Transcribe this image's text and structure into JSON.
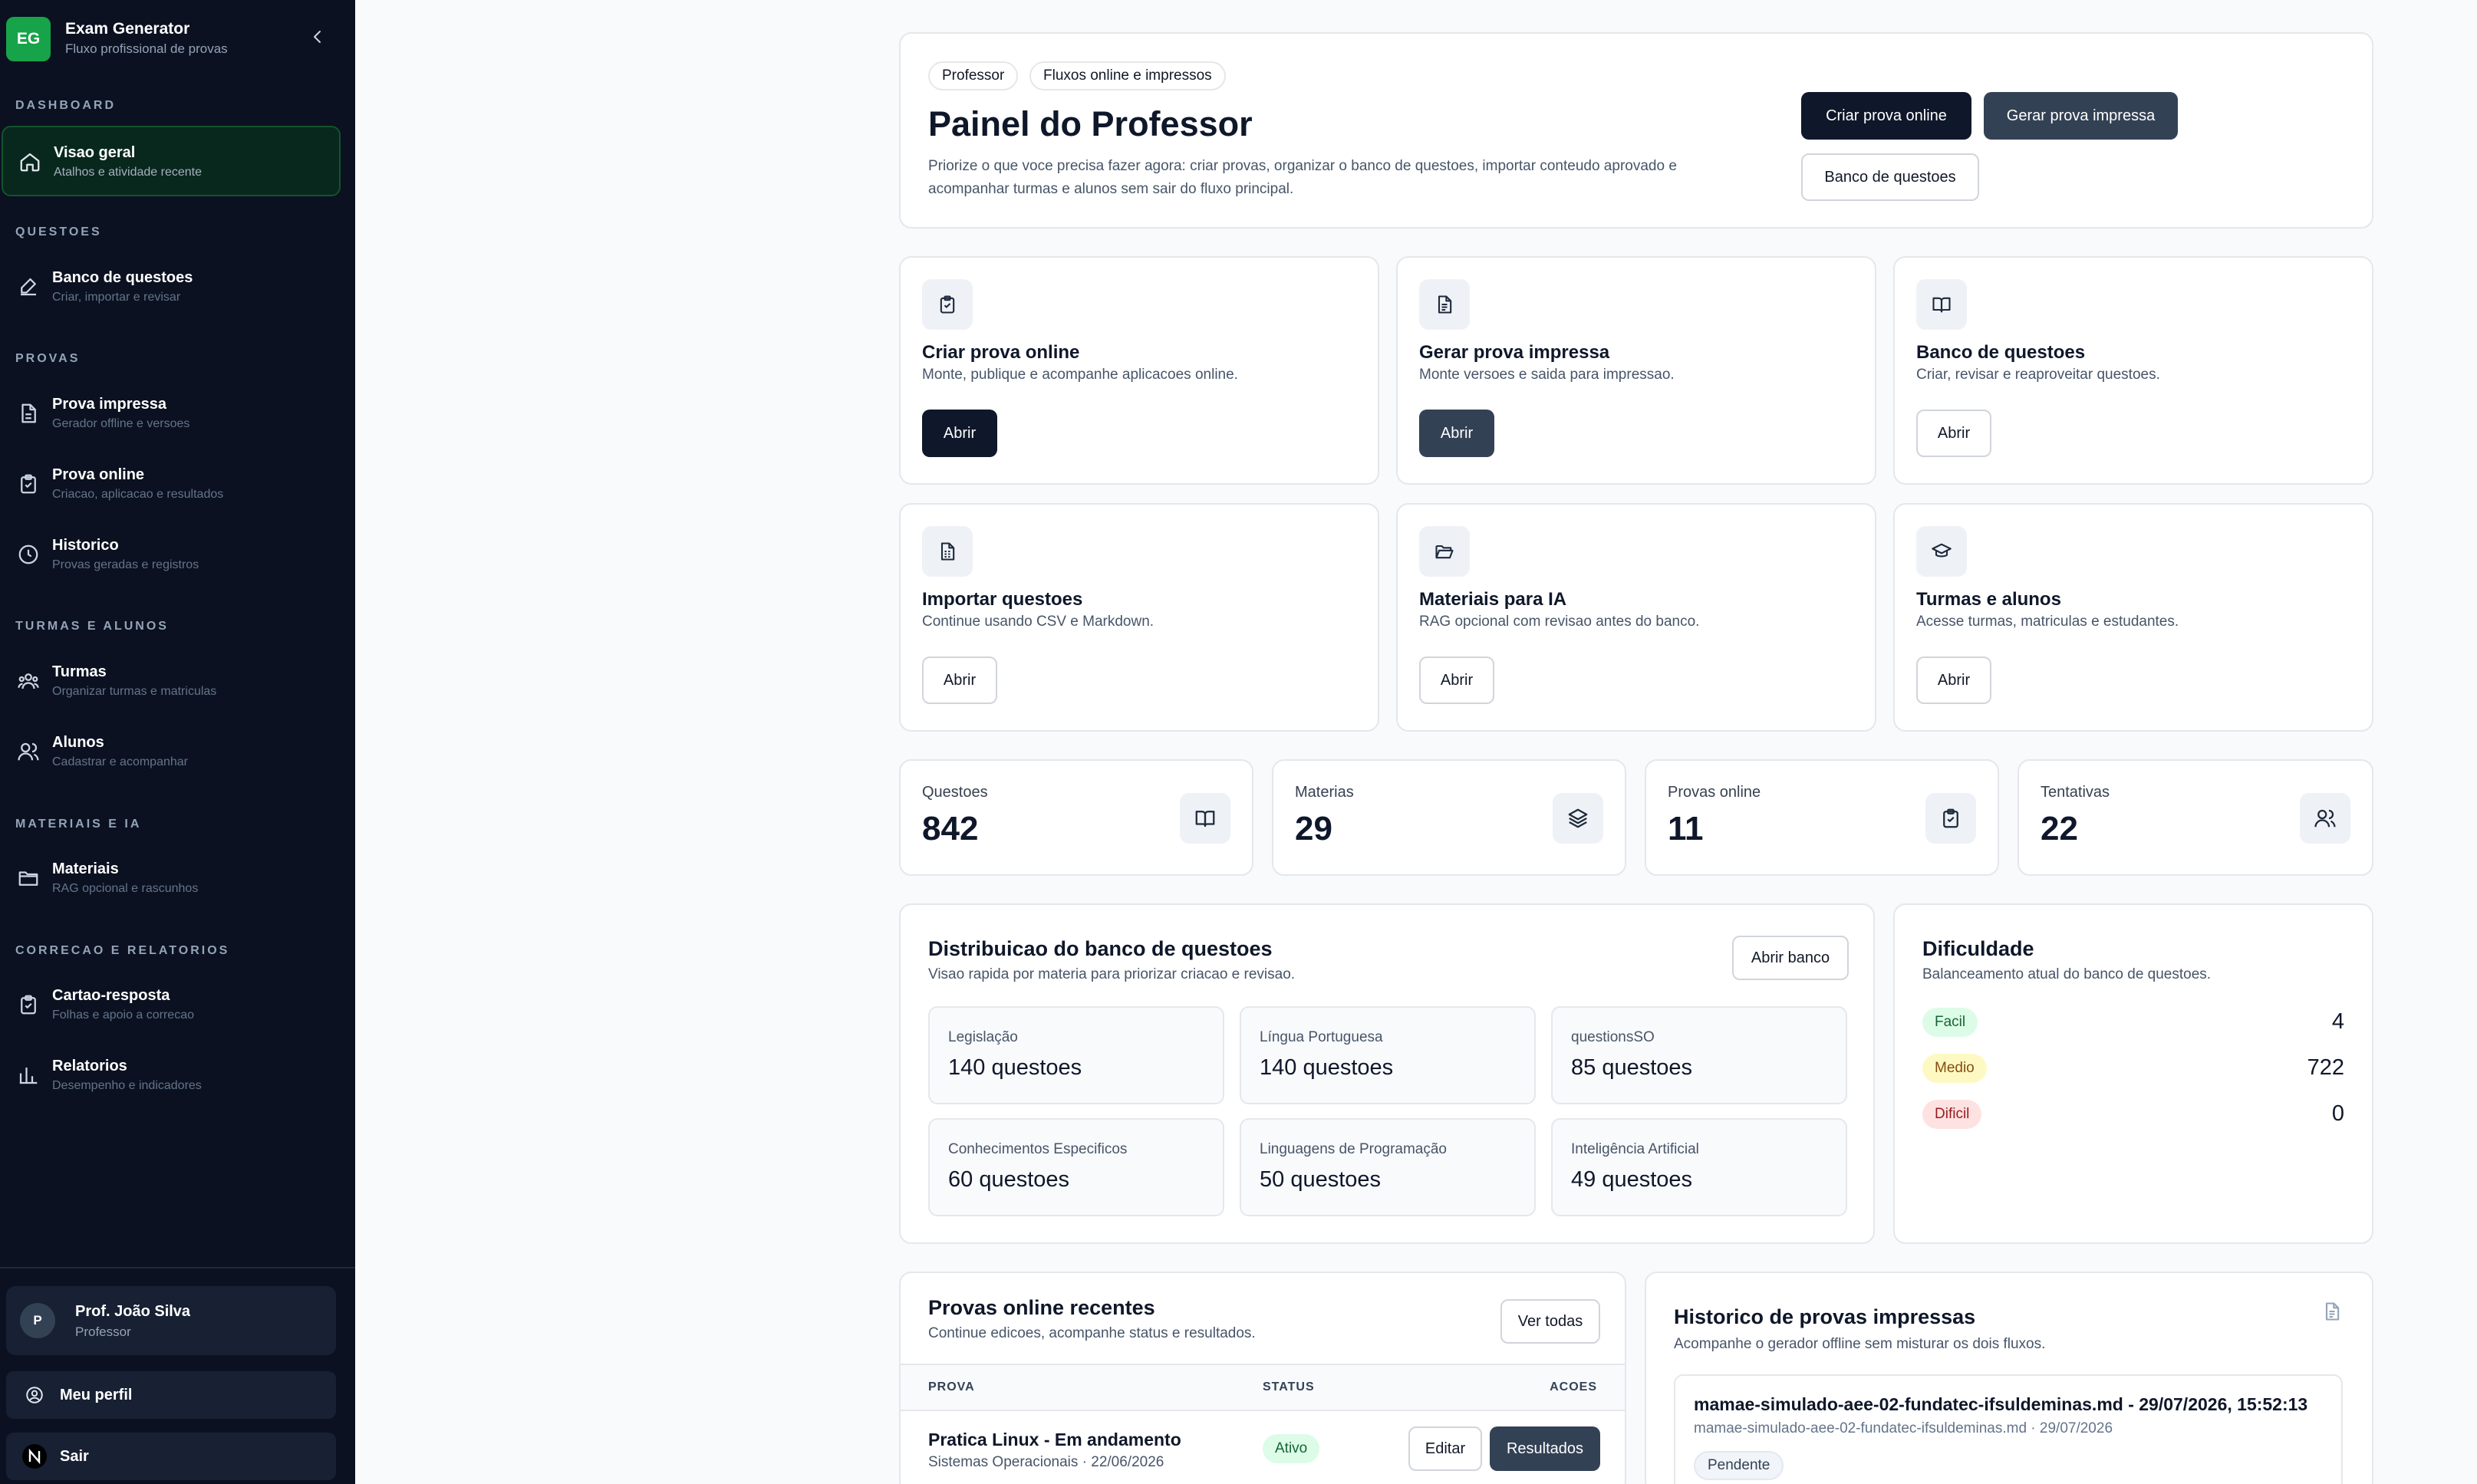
{
  "brand": {
    "logo": "EG",
    "title": "Exam Generator",
    "subtitle": "Fluxo profissional de provas"
  },
  "sidebar": {
    "sections": [
      "DASHBOARD",
      "QUESTOES",
      "PROVAS",
      "TURMAS E ALUNOS",
      "MATERIAIS E IA",
      "CORRECAO E RELATORIOS"
    ],
    "items": [
      {
        "title": "Visao geral",
        "sub": "Atalhos e atividade recente",
        "icon": "home-icon"
      },
      {
        "title": "Banco de questoes",
        "sub": "Criar, importar e revisar",
        "icon": "edit-icon"
      },
      {
        "title": "Prova impressa",
        "sub": "Gerador offline e versoes",
        "icon": "file-icon"
      },
      {
        "title": "Prova online",
        "sub": "Criacao, aplicacao e resultados",
        "icon": "clipboard-icon"
      },
      {
        "title": "Historico",
        "sub": "Provas geradas e registros",
        "icon": "clock-icon"
      },
      {
        "title": "Turmas",
        "sub": "Organizar turmas e matriculas",
        "icon": "group-icon"
      },
      {
        "title": "Alunos",
        "sub": "Cadastrar e acompanhar",
        "icon": "users-icon"
      },
      {
        "title": "Materiais",
        "sub": "RAG opcional e rascunhos",
        "icon": "folder-icon"
      },
      {
        "title": "Cartao-resposta",
        "sub": "Folhas e apoio a correcao",
        "icon": "clipboard-icon"
      },
      {
        "title": "Relatorios",
        "sub": "Desempenho e indicadores",
        "icon": "bar-chart-icon"
      }
    ],
    "user": {
      "initial": "P",
      "name": "Prof. João Silva",
      "role": "Professor"
    },
    "profile_label": "Meu perfil",
    "logout_label": "Sair"
  },
  "header": {
    "chips": [
      "Professor",
      "Fluxos online e impressos"
    ],
    "title": "Painel do Professor",
    "description": "Priorize o que voce precisa fazer agora: criar provas, organizar o banco de questoes, importar conteudo aprovado e acompanhar turmas e alunos sem sair do fluxo principal.",
    "btn_online": "Criar prova online",
    "btn_print": "Gerar prova impressa",
    "btn_bank": "Banco de questoes"
  },
  "actions": [
    {
      "title": "Criar prova online",
      "desc": "Monte, publique e acompanhe aplicacoes online.",
      "button": "Abrir",
      "icon": "clipboard-check-icon"
    },
    {
      "title": "Gerar prova impressa",
      "desc": "Monte versoes e saida para impressao.",
      "button": "Abrir",
      "icon": "file-text-icon"
    },
    {
      "title": "Banco de questoes",
      "desc": "Criar, revisar e reaproveitar questoes.",
      "button": "Abrir",
      "icon": "book-open-icon"
    },
    {
      "title": "Importar questoes",
      "desc": "Continue usando CSV e Markdown.",
      "button": "Abrir",
      "icon": "file-spreadsheet-icon"
    },
    {
      "title": "Materiais para IA",
      "desc": "RAG opcional com revisao antes do banco.",
      "button": "Abrir",
      "icon": "folder-open-icon"
    },
    {
      "title": "Turmas e alunos",
      "desc": "Acesse turmas, matriculas e estudantes.",
      "button": "Abrir",
      "icon": "graduation-cap-icon"
    }
  ],
  "stats": [
    {
      "label": "Questoes",
      "value": "842",
      "icon": "book-open-icon"
    },
    {
      "label": "Materias",
      "value": "29",
      "icon": "layers-icon"
    },
    {
      "label": "Provas online",
      "value": "11",
      "icon": "clipboard-check-icon"
    },
    {
      "label": "Tentativas",
      "value": "22",
      "icon": "users-icon"
    }
  ],
  "distribution": {
    "title": "Distribuicao do banco de questoes",
    "subtitle": "Visao rapida por materia para priorizar criacao e revisao.",
    "button": "Abrir banco",
    "tiles": [
      {
        "name": "Legislação",
        "value": "140 questoes"
      },
      {
        "name": "Língua Portuguesa",
        "value": "140 questoes"
      },
      {
        "name": "questionsSO",
        "value": "85 questoes"
      },
      {
        "name": "Conhecimentos Especificos",
        "value": "60 questoes"
      },
      {
        "name": "Linguagens de Programação",
        "value": "50 questoes"
      },
      {
        "name": "Inteligência Artificial",
        "value": "49 questoes"
      }
    ]
  },
  "difficulty": {
    "title": "Dificuldade",
    "subtitle": "Balanceamento atual do banco de questoes.",
    "rows": [
      {
        "label": "Facil",
        "value": "4",
        "bg": "#dcfce7",
        "fg": "#166534"
      },
      {
        "label": "Medio",
        "value": "722",
        "bg": "#fef9c3",
        "fg": "#854d0e"
      },
      {
        "label": "Dificil",
        "value": "0",
        "bg": "#fee2e2",
        "fg": "#991b1b"
      }
    ]
  },
  "recent": {
    "title": "Provas online recentes",
    "subtitle": "Continue edicoes, acompanhe status e resultados.",
    "button": "Ver todas",
    "columns": [
      "PROVA",
      "STATUS",
      "ACOES"
    ],
    "rows": [
      {
        "name": "Pratica Linux - Em andamento",
        "meta": "Sistemas Operacionais · 22/06/2026",
        "status": "Ativo",
        "edit": "Editar",
        "results": "Resultados"
      }
    ]
  },
  "history": {
    "title": "Historico de provas impressas",
    "subtitle": "Acompanhe o gerador offline sem misturar os dois fluxos.",
    "icon": "file-text-icon",
    "item": {
      "title": "mamae-simulado-aee-02-fundatec-ifsuldeminas.md - 29/07/2026, 15:52:13",
      "meta": "mamae-simulado-aee-02-fundatec-ifsuldeminas.md · 29/07/2026",
      "badge": "Pendente"
    }
  }
}
